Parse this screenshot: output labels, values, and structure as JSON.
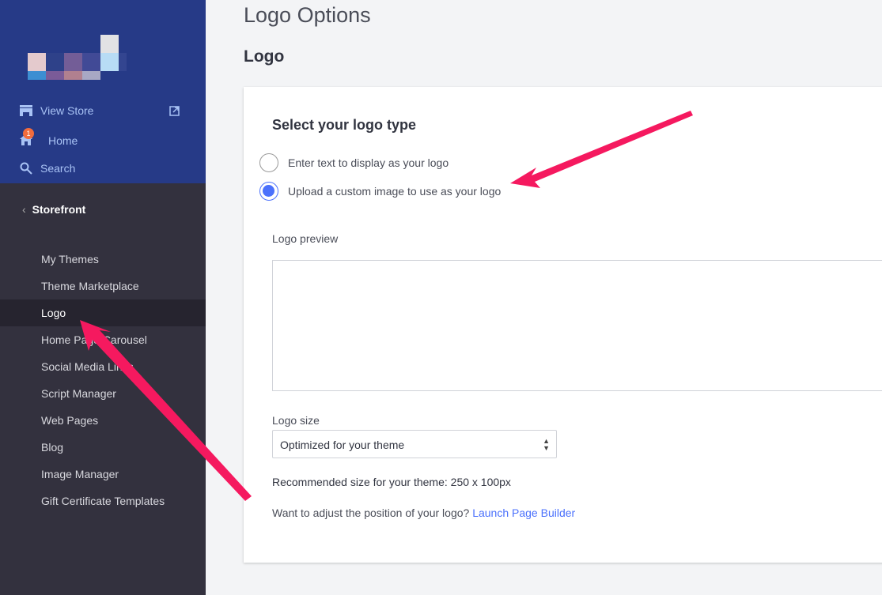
{
  "sidebar": {
    "top_links": [
      {
        "label": "View Store",
        "icon": "store-icon"
      },
      {
        "label": "Home",
        "icon": "home-icon",
        "badge": "1"
      },
      {
        "label": "Search",
        "icon": "search-icon"
      }
    ],
    "section": "Storefront",
    "items": [
      {
        "label": "My Themes"
      },
      {
        "label": "Theme Marketplace"
      },
      {
        "label": "Logo",
        "active": true
      },
      {
        "label": "Home Page Carousel"
      },
      {
        "label": "Social Media Links"
      },
      {
        "label": "Script Manager"
      },
      {
        "label": "Web Pages"
      },
      {
        "label": "Blog"
      },
      {
        "label": "Image Manager"
      },
      {
        "label": "Gift Certificate Templates"
      }
    ]
  },
  "page": {
    "title": "Logo Options",
    "subtitle": "Logo"
  },
  "card": {
    "heading": "Select your logo type",
    "options": [
      {
        "label": "Enter text to display as your logo",
        "selected": false
      },
      {
        "label": "Upload a custom image to use as your logo",
        "selected": true
      }
    ],
    "preview_label": "Logo preview",
    "size_label": "Logo size",
    "size_value": "Optimized for your theme",
    "recommended": "Recommended size for your theme: 250 x 100px",
    "adjust_text": "Want to adjust the position of your logo?",
    "adjust_link": "Launch Page Builder"
  },
  "colors": {
    "accent": "#4b71fc",
    "sidebar_top": "#263a87",
    "sidebar": "#33313e",
    "arrow": "#f5195f",
    "badge": "#f26c3d"
  }
}
